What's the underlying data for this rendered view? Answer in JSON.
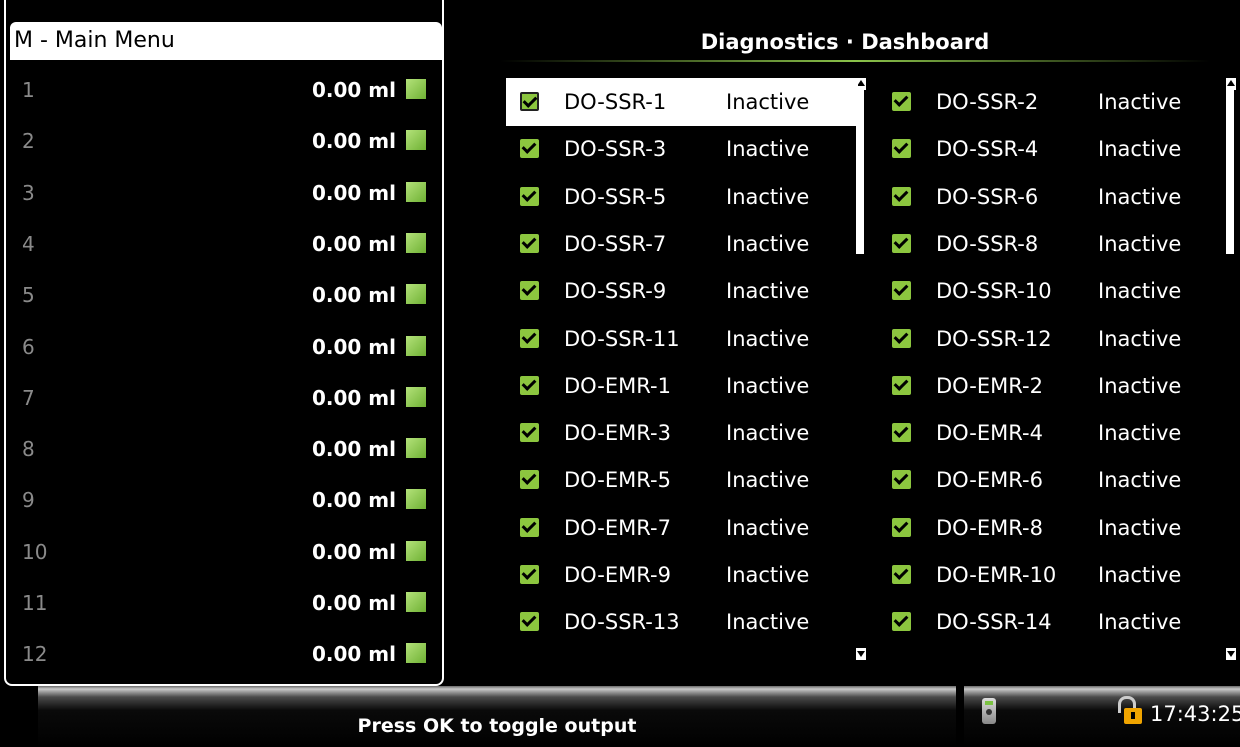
{
  "menu": {
    "header": "M - Main Menu"
  },
  "volumes": [
    {
      "index": "1",
      "value": "0.00 ml"
    },
    {
      "index": "2",
      "value": "0.00 ml"
    },
    {
      "index": "3",
      "value": "0.00 ml"
    },
    {
      "index": "4",
      "value": "0.00 ml"
    },
    {
      "index": "5",
      "value": "0.00 ml"
    },
    {
      "index": "6",
      "value": "0.00 ml"
    },
    {
      "index": "7",
      "value": "0.00 ml"
    },
    {
      "index": "8",
      "value": "0.00 ml"
    },
    {
      "index": "9",
      "value": "0.00 ml"
    },
    {
      "index": "10",
      "value": "0.00 ml"
    },
    {
      "index": "11",
      "value": "0.00 ml"
    },
    {
      "index": "12",
      "value": "0.00 ml"
    }
  ],
  "dashboard": {
    "title": "Diagnostics · Dashboard",
    "outputs_left": [
      {
        "name": "DO-SSR-1",
        "state": "Inactive",
        "checked": true,
        "selected": true
      },
      {
        "name": "DO-SSR-3",
        "state": "Inactive",
        "checked": true
      },
      {
        "name": "DO-SSR-5",
        "state": "Inactive",
        "checked": true
      },
      {
        "name": "DO-SSR-7",
        "state": "Inactive",
        "checked": true
      },
      {
        "name": "DO-SSR-9",
        "state": "Inactive",
        "checked": true
      },
      {
        "name": "DO-SSR-11",
        "state": "Inactive",
        "checked": true
      },
      {
        "name": "DO-EMR-1",
        "state": "Inactive",
        "checked": true
      },
      {
        "name": "DO-EMR-3",
        "state": "Inactive",
        "checked": true
      },
      {
        "name": "DO-EMR-5",
        "state": "Inactive",
        "checked": true
      },
      {
        "name": "DO-EMR-7",
        "state": "Inactive",
        "checked": true
      },
      {
        "name": "DO-EMR-9",
        "state": "Inactive",
        "checked": true
      },
      {
        "name": "DO-SSR-13",
        "state": "Inactive",
        "checked": true
      }
    ],
    "outputs_right": [
      {
        "name": "DO-SSR-2",
        "state": "Inactive",
        "checked": true
      },
      {
        "name": "DO-SSR-4",
        "state": "Inactive",
        "checked": true
      },
      {
        "name": "DO-SSR-6",
        "state": "Inactive",
        "checked": true
      },
      {
        "name": "DO-SSR-8",
        "state": "Inactive",
        "checked": true
      },
      {
        "name": "DO-SSR-10",
        "state": "Inactive",
        "checked": true
      },
      {
        "name": "DO-SSR-12",
        "state": "Inactive",
        "checked": true
      },
      {
        "name": "DO-EMR-2",
        "state": "Inactive",
        "checked": true
      },
      {
        "name": "DO-EMR-4",
        "state": "Inactive",
        "checked": true
      },
      {
        "name": "DO-EMR-6",
        "state": "Inactive",
        "checked": true
      },
      {
        "name": "DO-EMR-8",
        "state": "Inactive",
        "checked": true
      },
      {
        "name": "DO-EMR-10",
        "state": "Inactive",
        "checked": true
      },
      {
        "name": "DO-SSR-14",
        "state": "Inactive",
        "checked": true
      }
    ]
  },
  "status_bar": {
    "message": "Press OK to toggle output",
    "time": "17:43:25",
    "icons": [
      "device-icon",
      "lock-icon"
    ]
  },
  "colors": {
    "accent_green": "#8cc63f",
    "background": "#000000",
    "text": "#ffffff"
  }
}
